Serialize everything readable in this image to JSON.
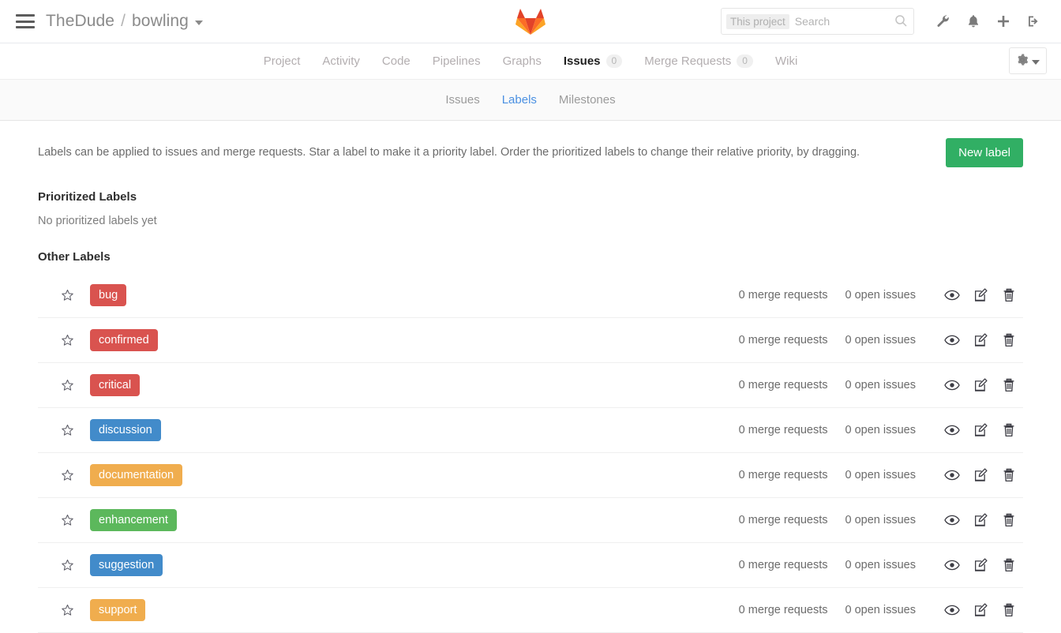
{
  "header": {
    "menu_icon": "hamburger-icon",
    "namespace": "TheDude",
    "separator": "/",
    "project": "bowling",
    "logo": "gitlab-logo",
    "search": {
      "scope_label": "This project",
      "placeholder": "Search",
      "value": "",
      "icon": "search-icon"
    },
    "icons": [
      {
        "name": "wrench-icon",
        "label": "Admin area"
      },
      {
        "name": "bell-icon",
        "label": "Todos"
      },
      {
        "name": "plus-icon",
        "label": "New"
      },
      {
        "name": "sign-out-icon",
        "label": "Sign out"
      }
    ]
  },
  "primary_nav": {
    "items": [
      {
        "label": "Project",
        "active": false,
        "count": null
      },
      {
        "label": "Activity",
        "active": false,
        "count": null
      },
      {
        "label": "Code",
        "active": false,
        "count": null
      },
      {
        "label": "Pipelines",
        "active": false,
        "count": null
      },
      {
        "label": "Graphs",
        "active": false,
        "count": null
      },
      {
        "label": "Issues",
        "active": true,
        "count": "0"
      },
      {
        "label": "Merge Requests",
        "active": false,
        "count": "0"
      },
      {
        "label": "Wiki",
        "active": false,
        "count": null
      }
    ],
    "settings_button": {
      "icon": "gear-icon",
      "caret": "caret-down-icon"
    }
  },
  "sub_nav": {
    "items": [
      {
        "label": "Issues",
        "active": false
      },
      {
        "label": "Labels",
        "active": true
      },
      {
        "label": "Milestones",
        "active": false
      }
    ]
  },
  "main": {
    "intro_text": "Labels can be applied to issues and merge requests. Star a label to make it a priority label. Order the prioritized labels to change their relative priority, by dragging.",
    "new_label_button": "New label",
    "prioritized": {
      "title": "Prioritized Labels",
      "empty_text": "No prioritized labels yet"
    },
    "other": {
      "title": "Other Labels",
      "labels": [
        {
          "name": "bug",
          "color": "#d9534f",
          "merge_requests": "0 merge requests",
          "open_issues": "0 open issues"
        },
        {
          "name": "confirmed",
          "color": "#d9534f",
          "merge_requests": "0 merge requests",
          "open_issues": "0 open issues"
        },
        {
          "name": "critical",
          "color": "#d9534f",
          "merge_requests": "0 merge requests",
          "open_issues": "0 open issues"
        },
        {
          "name": "discussion",
          "color": "#428bca",
          "merge_requests": "0 merge requests",
          "open_issues": "0 open issues"
        },
        {
          "name": "documentation",
          "color": "#f0ad4e",
          "merge_requests": "0 merge requests",
          "open_issues": "0 open issues"
        },
        {
          "name": "enhancement",
          "color": "#5cb85c",
          "merge_requests": "0 merge requests",
          "open_issues": "0 open issues"
        },
        {
          "name": "suggestion",
          "color": "#428bca",
          "merge_requests": "0 merge requests",
          "open_issues": "0 open issues"
        },
        {
          "name": "support",
          "color": "#f0ad4e",
          "merge_requests": "0 merge requests",
          "open_issues": "0 open issues"
        }
      ],
      "row_actions": [
        {
          "name": "subscribe-icon",
          "title": "Subscribe"
        },
        {
          "name": "edit-icon",
          "title": "Edit"
        },
        {
          "name": "delete-icon",
          "title": "Delete"
        }
      ],
      "star_icon": "star-outline-icon"
    }
  },
  "theme": {
    "accent_green": "#31af64",
    "link_blue": "#4a90e2",
    "text_dark": "#2e2e2e",
    "text_muted": "#6b6b6b"
  }
}
